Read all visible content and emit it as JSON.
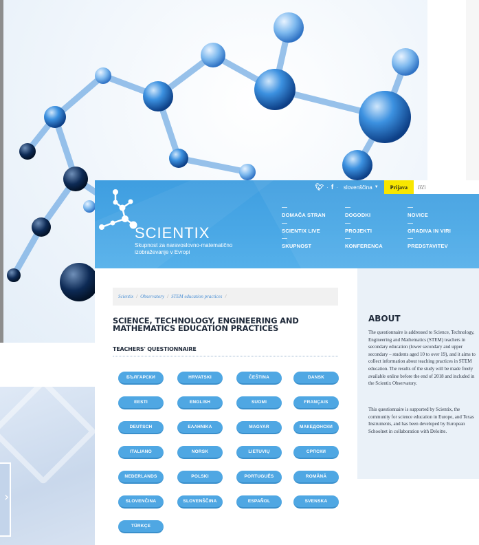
{
  "topbar": {
    "twitter_icon": "twitter-bird-icon",
    "facebook_icon": "facebook-f-icon",
    "language": "slovenščina",
    "login_label": "Prijava",
    "search_placeholder": "Išči"
  },
  "brand": {
    "name": "SCIENTIX",
    "tagline": "Skupnost za naravoslovno-matematično izobraževanje v Evropi"
  },
  "nav": {
    "items": [
      "DOMAČA STRAN",
      "SCIENTIX LIVE",
      "SKUPNOST",
      "DOGODKI",
      "PROJEKTI",
      "KONFERENCA",
      "NOVICE",
      "GRADIVA IN VIRI",
      "PREDSTAVITEV"
    ]
  },
  "breadcrumb": [
    "Scientix",
    "Observatory",
    "STEM education practices"
  ],
  "page": {
    "title": "SCIENCE, TECHNOLOGY, ENGINEERING AND MATHEMATICS EDUCATION PRACTICES",
    "subtitle": "TEACHERS' QUESTIONNAIRE"
  },
  "languages": [
    "БЪЛГАРСКИ",
    "HRVATSKI",
    "ČEŠTINA",
    "DANSK",
    "EESTI",
    "ENGLISH",
    "SUOMI",
    "FRANÇAIS",
    "DEUTSCH",
    "ΕΛΛΗΝΙΚΑ",
    "MAGYAR",
    "МАКЕДОНСКИ",
    "ITALIANO",
    "NORSK",
    "LIETUVIŲ",
    "СРПСКИ",
    "NEDERLANDS",
    "POLSKI",
    "PORTUGUÊS",
    "ROMÂNĂ",
    "SLOVENČINA",
    "SLOVENŠČINA",
    "ESPAÑOL",
    "SVENSKA",
    "TÜRKÇE"
  ],
  "about": {
    "title": "ABOUT",
    "p1": "The questionnaire is addressed to Science, Technology, Engineering and Mathematics (STEM) teachers in secondary education (lower secondary and upper secondary – students aged 10 to over 19), and it aims to collect information about teaching practices in STEM education. The results of the study will be made freely available online before the end of 2018 and included in the Scientix Observatory.",
    "p2": "This questionnaire is supported by Scientix, the community for science education in Europe, and Texas Instruments, and has been developed by European Schoolnet in collaboration with Deloitte."
  },
  "colors": {
    "header_blue": "#4aa8e6",
    "button_blue": "#4fa7e3",
    "login_yellow": "#f8e600",
    "about_bg": "#eaf1f8"
  }
}
